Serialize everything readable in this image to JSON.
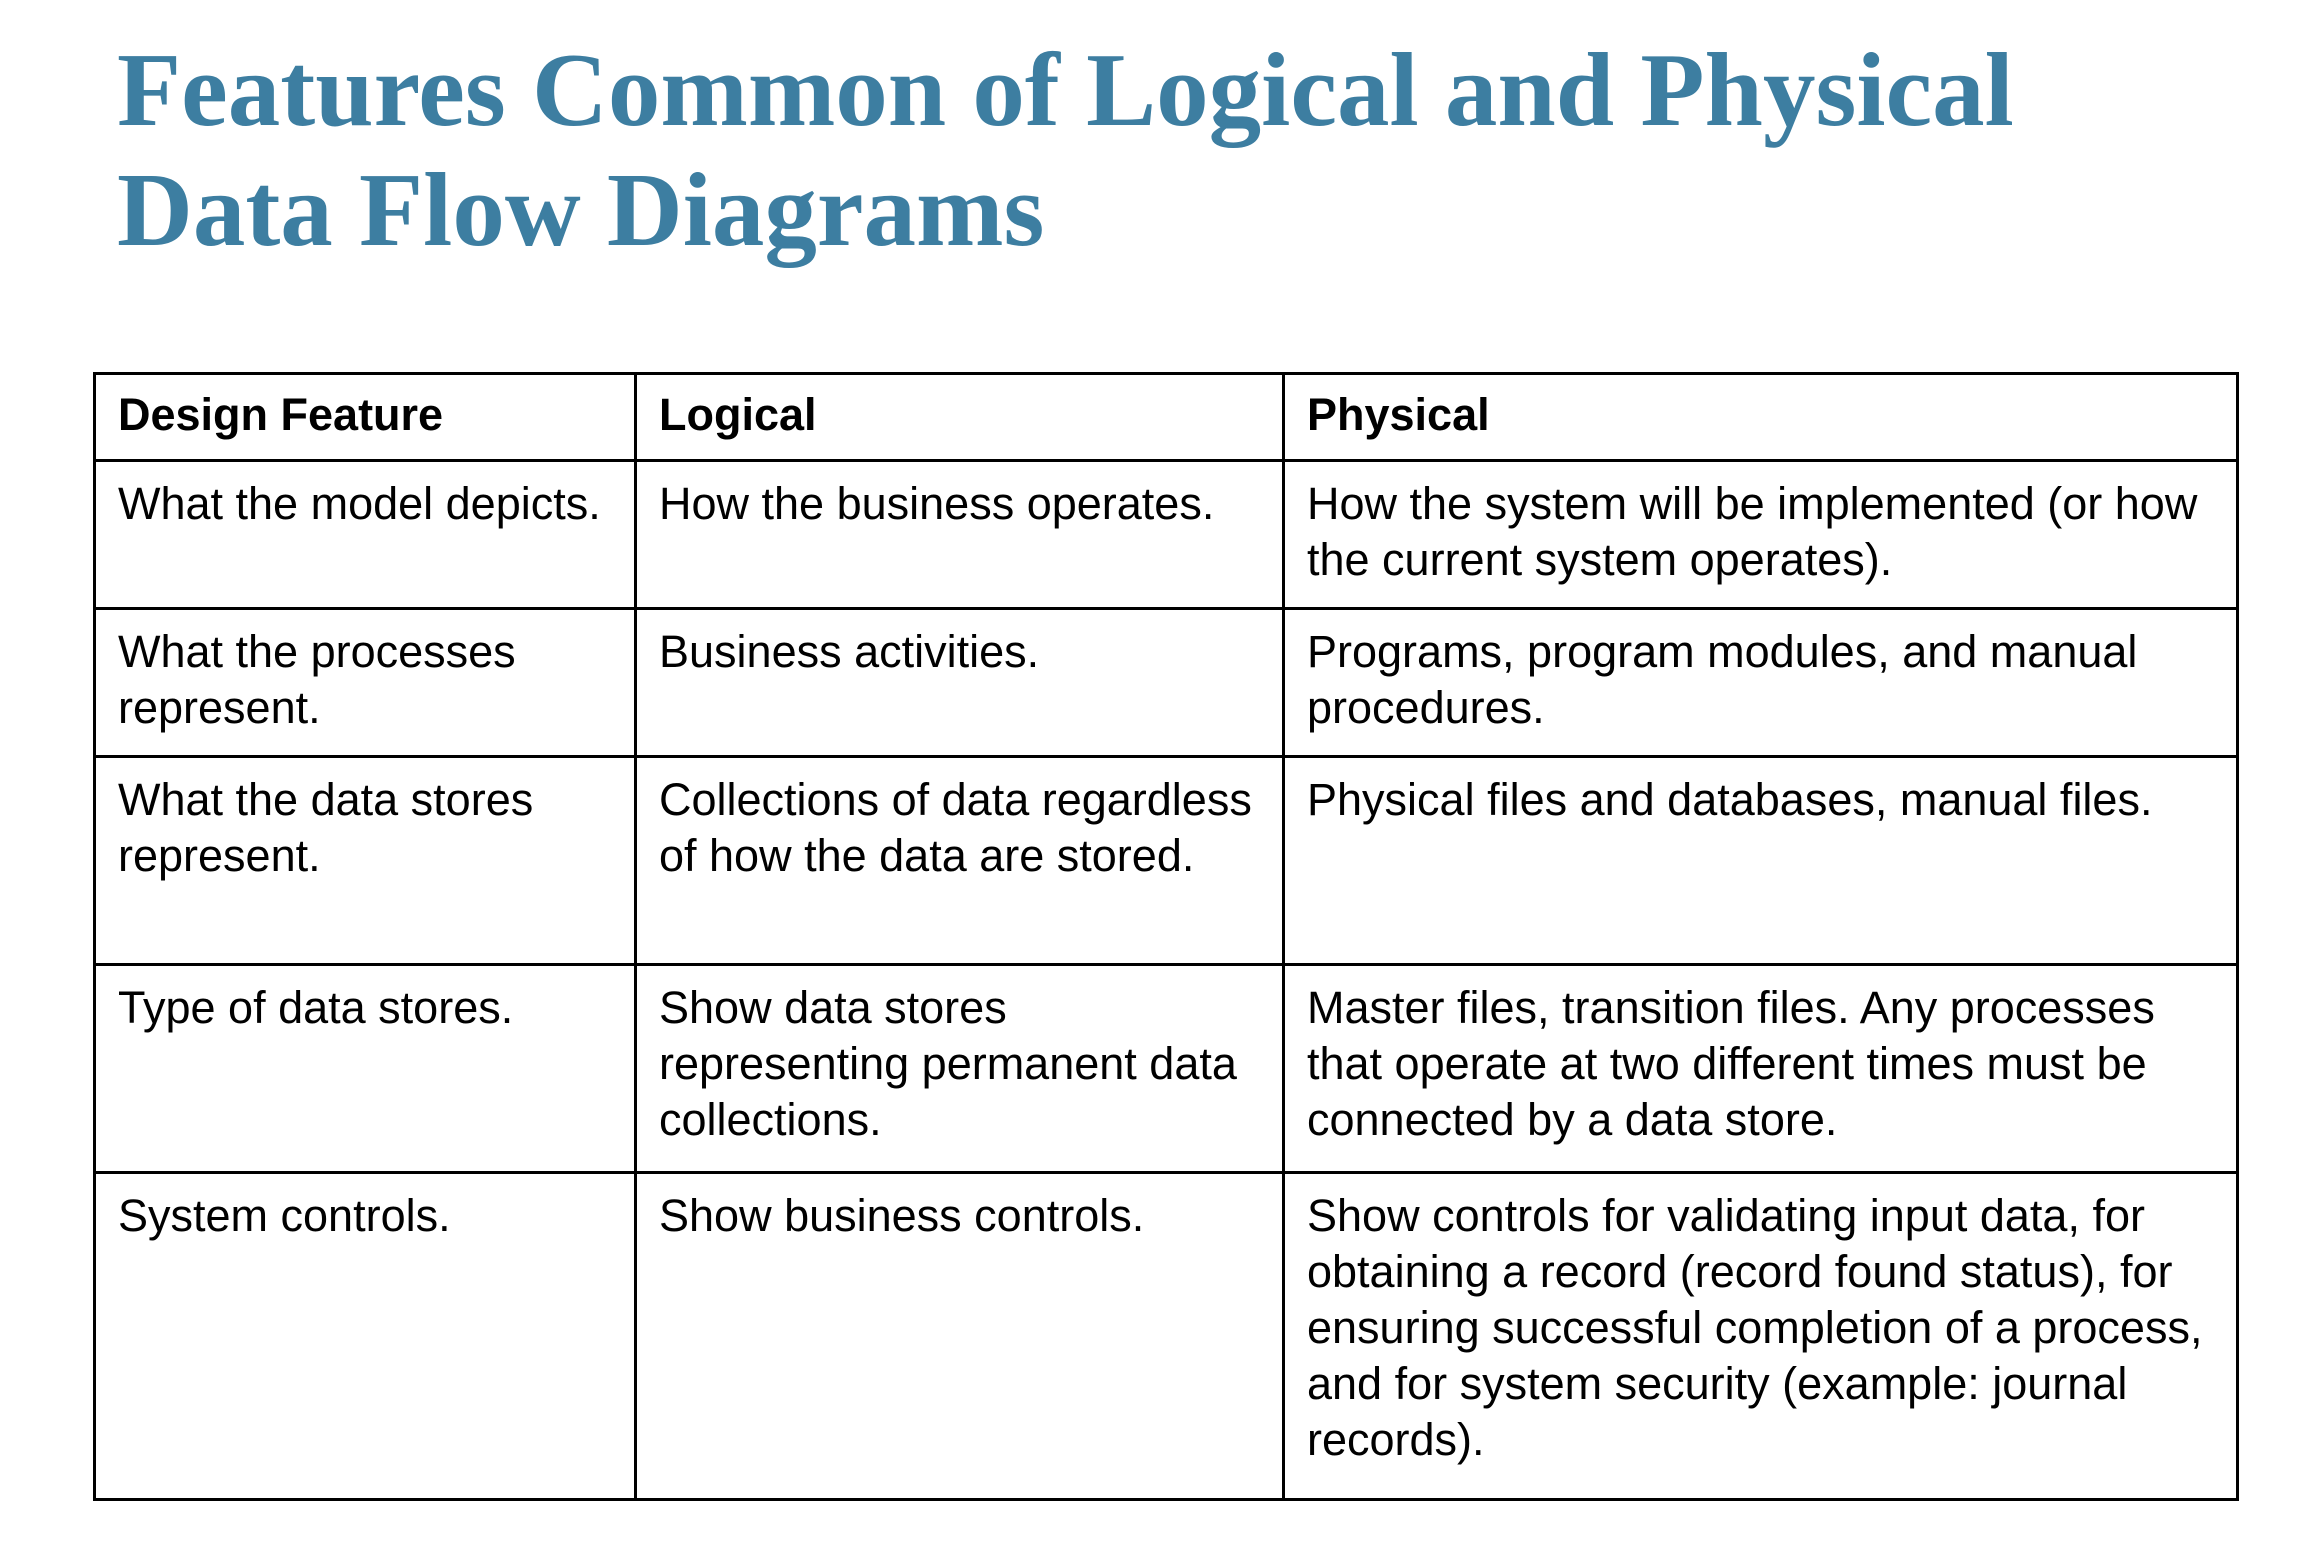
{
  "title": "Features Common of Logical and Physical Data Flow Diagrams",
  "table": {
    "headers": [
      "Design Feature",
      "Logical",
      "Physical"
    ],
    "rows": [
      {
        "feature": "What the model depicts.",
        "logical": "How the business operates.",
        "physical": "How the system will be implemented (or how the current system operates)."
      },
      {
        "feature": "What the processes represent.",
        "logical": "Business activities.",
        "physical": "Programs, program modules, and manual procedures."
      },
      {
        "feature": "What the data stores represent.",
        "logical": "Collections of data regardless of how the data are stored.",
        "physical": "Physical files and databases, manual files."
      },
      {
        "feature": "Type of data stores.",
        "logical": "Show data stores representing permanent data collections.",
        "physical": "Master files, transition files. Any processes that operate at two different times must be connected by a data store."
      },
      {
        "feature": "System controls.",
        "logical": "Show business controls.",
        "physical": "Show controls for validating input data, for obtaining a record (record found status), for ensuring successful completion of a process, and for system security (example: journal records)."
      }
    ]
  }
}
